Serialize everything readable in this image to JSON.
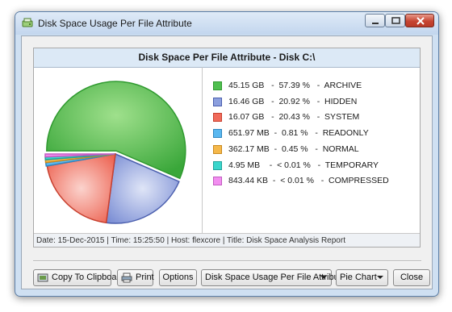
{
  "window": {
    "title": "Disk Space Usage Per File Attribute"
  },
  "report": {
    "header": "Disk Space Per File Attribute - Disk C:\\",
    "footer": "Date: 15-Dec-2015 | Time: 15:25:50 | Host: flexcore | Title: Disk Space Analysis Report"
  },
  "chart_data": {
    "type": "pie",
    "title": "Disk Space Per File Attribute - Disk C:\\",
    "slices": [
      {
        "label": "ARCHIVE",
        "size": "45.15 GB",
        "percent_text": "57.39 %",
        "value": 57.39,
        "color": "#4fbf4f",
        "edge": "#2f9a2f"
      },
      {
        "label": "HIDDEN",
        "size": "16.46 GB",
        "percent_text": "20.92 %",
        "value": 20.92,
        "color": "#8c9fde",
        "edge": "#4b5fae"
      },
      {
        "label": "SYSTEM",
        "size": "16.07 GB",
        "percent_text": "20.43 %",
        "value": 20.43,
        "color": "#f06a5a",
        "edge": "#c8402f"
      },
      {
        "label": "READONLY",
        "size": "651.97 MB",
        "percent_text": "0.81 %",
        "value": 0.81,
        "color": "#5ab8f0",
        "edge": "#2f86c0"
      },
      {
        "label": "NORMAL",
        "size": "362.17 MB",
        "percent_text": "0.45 %",
        "value": 0.45,
        "color": "#f5b84a",
        "edge": "#c98a1f"
      },
      {
        "label": "TEMPORARY",
        "size": "4.95 MB",
        "percent_text": "< 0.01 %",
        "value": 0.005,
        "color": "#3ad6cc",
        "edge": "#1fa39a"
      },
      {
        "label": "COMPRESSED",
        "size": "843.44 KB",
        "percent_text": "< 0.01 %",
        "value": 0.005,
        "color": "#f28ef0",
        "edge": "#c25cc0"
      }
    ],
    "legend_position": "right"
  },
  "toolbar": {
    "copy_label": "Copy To Clipboard",
    "print_label": "Print",
    "options_label": "Options",
    "report_select_value": "Disk Space Usage Per File Attribute",
    "chart_select_value": "Pie Chart",
    "close_label": "Close"
  },
  "icons": {
    "copy": "clipboard-icon",
    "print": "printer-icon",
    "app": "disk-icon"
  }
}
